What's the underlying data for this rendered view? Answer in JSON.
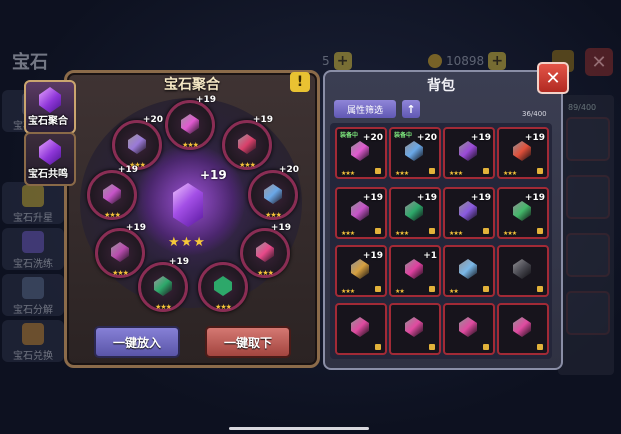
{
  "background": {
    "title": "宝石",
    "currency_1": {
      "value": "5",
      "plus": "+"
    },
    "currency_2": {
      "value": "10898",
      "plus": "+"
    },
    "close_label": "✕",
    "side_tabs": [
      {
        "label": "宝石锻造"
      },
      {
        "label": "宝石升星"
      },
      {
        "label": "宝石洗练"
      },
      {
        "label": "宝石分解"
      },
      {
        "label": "宝石兑换"
      }
    ],
    "right_count": "89/400"
  },
  "tabs": [
    {
      "label": "宝石聚合",
      "active": true
    },
    {
      "label": "宝石共鸣",
      "active": false
    }
  ],
  "fusion": {
    "title": "宝石聚合",
    "warn_icon": "!",
    "center": {
      "level": "+19",
      "stars": "★★★"
    },
    "slots": [
      {
        "level": "+19",
        "stars": "★★★",
        "color": "#e05ad0"
      },
      {
        "level": "+19",
        "stars": "★★★",
        "color": "#d9406a"
      },
      {
        "level": "+20",
        "stars": "★★★",
        "color": "#9a7ad8"
      },
      {
        "level": "+20",
        "stars": "★★★",
        "color": "#6aa8e8"
      },
      {
        "level": "+19",
        "stars": "★★★",
        "color": "#c654c8"
      },
      {
        "level": "+19",
        "stars": "★★★",
        "color": "#b84cae"
      },
      {
        "level": "+19",
        "stars": "★★★",
        "color": "#e84a8a"
      },
      {
        "level": "+19",
        "stars": "★★★",
        "color": "#2da86a"
      }
    ],
    "put_button": "一键放入",
    "take_button": "一键取下"
  },
  "bag": {
    "title": "背包",
    "close_label": "✕",
    "filter_button": "属性筛选",
    "sort_icon": "↑",
    "count": "36/400",
    "items": [
      {
        "equipped": "装备中",
        "level": "+20",
        "stars": "★★★",
        "color": "#e05ad0"
      },
      {
        "equipped": "装备中",
        "level": "+20",
        "stars": "★★★",
        "color": "#6aa8e8"
      },
      {
        "equipped": "",
        "level": "+19",
        "stars": "★★★",
        "color": "#9a4ad8"
      },
      {
        "equipped": "",
        "level": "+19",
        "stars": "★★★",
        "color": "#e0503a"
      },
      {
        "equipped": "",
        "level": "+19",
        "stars": "★★★",
        "color": "#c654c8"
      },
      {
        "equipped": "",
        "level": "+19",
        "stars": "★★★",
        "color": "#2da86a"
      },
      {
        "equipped": "",
        "level": "+19",
        "stars": "★★★",
        "color": "#8a5ae0"
      },
      {
        "equipped": "",
        "level": "+19",
        "stars": "★★★",
        "color": "#44b86a"
      },
      {
        "equipped": "",
        "level": "+19",
        "stars": "★★★",
        "color": "#d6a040"
      },
      {
        "equipped": "",
        "level": "+1",
        "stars": "★★",
        "color": "#e040a0"
      },
      {
        "equipped": "",
        "level": "",
        "stars": "★★",
        "color": "#7ab8e8"
      },
      {
        "equipped": "",
        "level": "",
        "stars": "",
        "color": "#4a4a52"
      },
      {
        "equipped": "",
        "level": "",
        "stars": "",
        "color": "#e04aa0"
      },
      {
        "equipped": "",
        "level": "",
        "stars": "",
        "color": "#e04aa0"
      },
      {
        "equipped": "",
        "level": "",
        "stars": "",
        "color": "#e04aa0"
      },
      {
        "equipped": "",
        "level": "",
        "stars": "",
        "color": "#e04aa0"
      }
    ]
  }
}
